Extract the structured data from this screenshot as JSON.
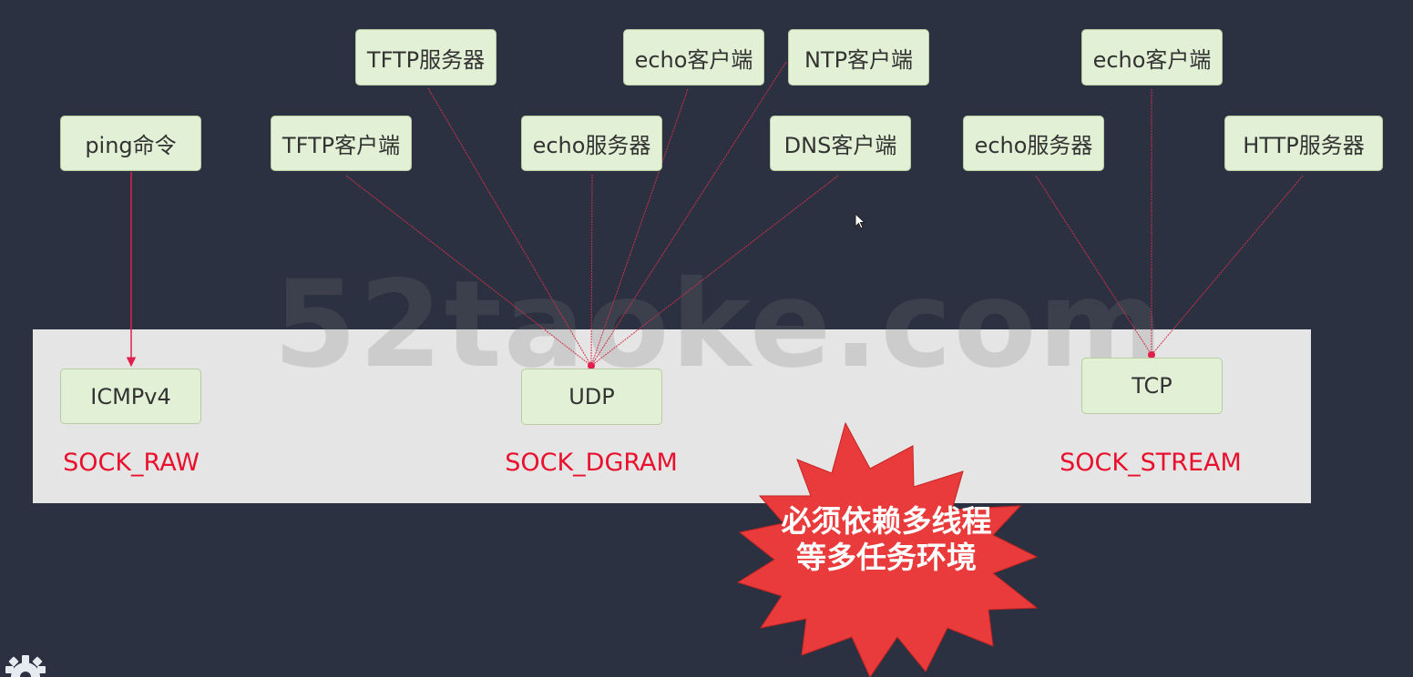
{
  "watermark": "52taoke.com",
  "apps": {
    "ping": "ping命令",
    "tftp_client": "TFTP客户端",
    "tftp_server": "TFTP服务器",
    "udp_echo_server": "echo服务器",
    "udp_echo_client": "echo客户端",
    "ntp_client": "NTP客户端",
    "dns_client": "DNS客户端",
    "tcp_echo_server": "echo服务器",
    "tcp_echo_client": "echo客户端",
    "http_server": "HTTP服务器"
  },
  "protocols": {
    "icmp": "ICMPv4",
    "udp": "UDP",
    "tcp": "TCP"
  },
  "socket_types": {
    "raw": "SOCK_RAW",
    "dgram": "SOCK_DGRAM",
    "stream": "SOCK_STREAM"
  },
  "callout": {
    "line1": "必须依赖多线程",
    "line2": "等多任务环境"
  },
  "colors": {
    "background": "#2b3140",
    "node_fill": "#e2f0d5",
    "link": "#e0204a",
    "label": "#e8102c",
    "burst": "#e93b3b"
  }
}
